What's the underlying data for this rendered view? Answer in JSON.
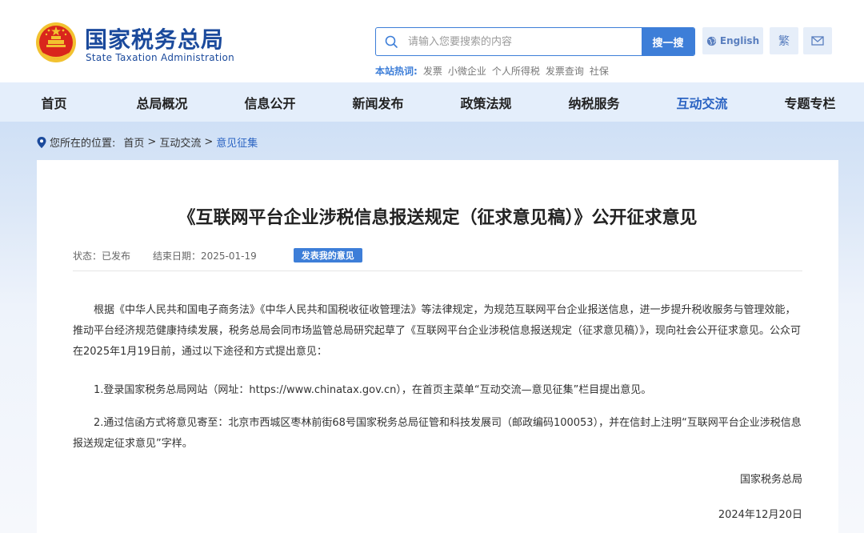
{
  "header": {
    "brand_cn": "国家税务总局",
    "brand_en": "State Taxation Administration",
    "search": {
      "placeholder": "请输入您要搜索的内容",
      "button_label": "搜一搜"
    },
    "hot_label": "本站热词:",
    "hot_words": [
      "发票",
      "小微企业",
      "个人所得税",
      "发票查询",
      "社保"
    ],
    "english_label": "English",
    "traditional_label": "繁"
  },
  "nav": {
    "items": [
      {
        "label": "首页"
      },
      {
        "label": "总局概况"
      },
      {
        "label": "信息公开"
      },
      {
        "label": "新闻发布"
      },
      {
        "label": "政策法规"
      },
      {
        "label": "纳税服务"
      },
      {
        "label": "互动交流"
      },
      {
        "label": "专题专栏"
      }
    ],
    "active": "互动交流"
  },
  "breadcrumb": {
    "prefix": "您所在的位置:",
    "home": "首页",
    "sep1": ">",
    "section": "互动交流",
    "sep2": ">",
    "current": "意见征集"
  },
  "article": {
    "title": "《互联网平台企业涉税信息报送规定（征求意见稿）》公开征求意见",
    "status": "状态：已发布",
    "end_date": "结束日期：2025-01-19",
    "comment_button": "发表我的意见",
    "p1": "根据《中华人民共和国电子商务法》《中华人民共和国税收征收管理法》等法律规定，为规范互联网平台企业报送信息，进一步提升税收服务与管理效能，推动平台经济规范健康持续发展，税务总局会同市场监管总局研究起草了《互联网平台企业涉税信息报送规定（征求意见稿）》，现向社会公开征求意见。公众可在2025年1月19日前，通过以下途径和方式提出意见：",
    "p2": "1.登录国家税务总局网站（网址：https://www.chinatax.gov.cn），在首页主菜单“互动交流—意见征集”栏目提出意见。",
    "p3": "2.通过信函方式将意见寄至：北京市西城区枣林前街68号国家税务总局征管和科技发展司（邮政编码100053），并在信封上注明“互联网平台企业涉税信息报送规定征求意见”字样。",
    "signature": "国家税务总局",
    "date": "2024年12月20日"
  },
  "colors": {
    "brand_blue": "#1b4a9c",
    "accent_blue": "#3d7ed8",
    "nav_bg": "#e4eefb",
    "emblem_red": "#d9261c",
    "emblem_gold": "#f2c230"
  }
}
